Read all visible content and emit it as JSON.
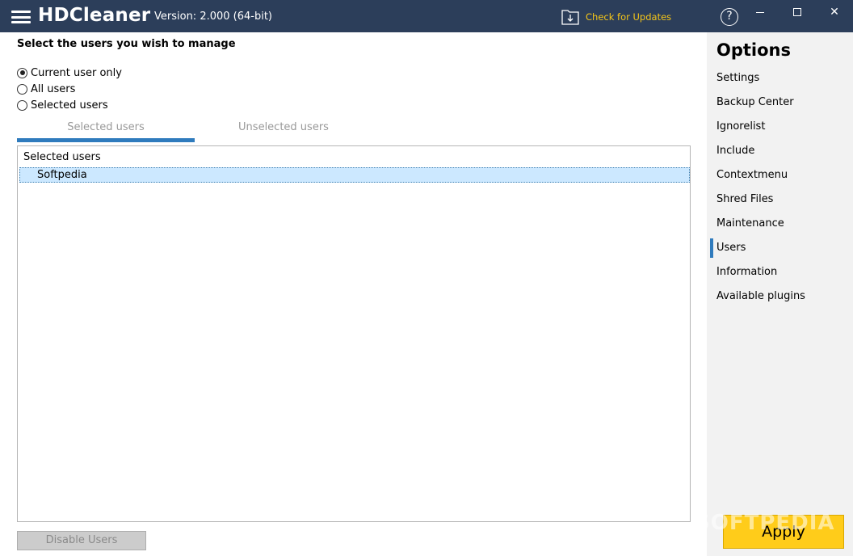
{
  "titlebar": {
    "app_name": "HDCleaner",
    "version": "Version: 2.000 (64-bit)",
    "update_label": "Check for Updates",
    "help_glyph": "?",
    "close_glyph": "✕"
  },
  "main": {
    "section_title": "Select the users you wish to manage",
    "radios": [
      {
        "label": "Current user only",
        "checked": true
      },
      {
        "label": "All users",
        "checked": false
      },
      {
        "label": "Selected users",
        "checked": false
      }
    ],
    "tabs": [
      {
        "label": "Selected users",
        "active": true
      },
      {
        "label": "Unselected users",
        "active": false
      }
    ],
    "list": {
      "header": "Selected users",
      "items": [
        "Softpedia"
      ]
    },
    "disable_button": "Disable Users"
  },
  "sidebar": {
    "title": "Options",
    "items": [
      {
        "label": "Settings"
      },
      {
        "label": "Backup Center"
      },
      {
        "label": "Ignorelist"
      },
      {
        "label": "Include"
      },
      {
        "label": "Contextmenu"
      },
      {
        "label": "Shred Files"
      },
      {
        "label": "Maintenance"
      },
      {
        "label": "Users",
        "active": true
      },
      {
        "label": "Information"
      },
      {
        "label": "Available plugins"
      }
    ]
  },
  "apply_button": "Apply",
  "watermark": "SOFTPEDIA",
  "icons": {
    "menu": "hamburger-icon",
    "update": "update-download-icon",
    "help": "help-icon",
    "minimize": "minimize-icon",
    "maximize": "maximize-icon",
    "close": "close-icon"
  },
  "colors": {
    "titlebar": "#2c3e5a",
    "accent": "#2f7bbd",
    "update_text": "#f5c518",
    "apply": "#ffcc1a",
    "selection": "#cce8ff",
    "sidebar_bg": "#f2f2f2"
  }
}
